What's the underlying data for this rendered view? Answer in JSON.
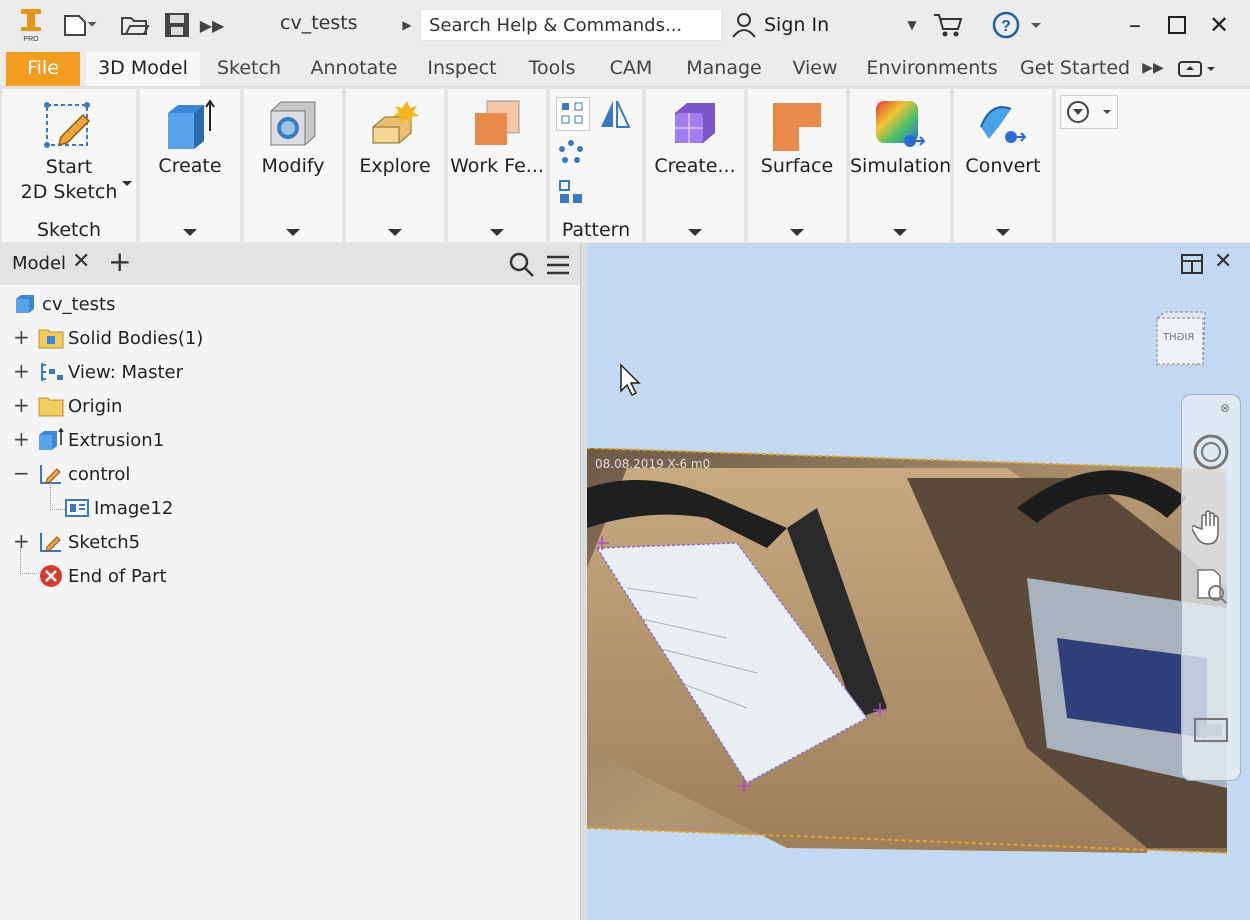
{
  "titlebar": {
    "doc_title": "cv_tests",
    "search_placeholder": "Search Help & Commands...",
    "sign_in": "Sign In"
  },
  "menu": {
    "tabs": [
      {
        "label": "File"
      },
      {
        "label": "3D Model"
      },
      {
        "label": "Sketch"
      },
      {
        "label": "Annotate"
      },
      {
        "label": "Inspect"
      },
      {
        "label": "Tools"
      },
      {
        "label": "CAM"
      },
      {
        "label": "Manage"
      },
      {
        "label": "View"
      },
      {
        "label": "Environments"
      },
      {
        "label": "Get Started"
      }
    ]
  },
  "ribbon": {
    "start_sketch": {
      "line1": "Start",
      "line2": "2D Sketch",
      "footer": "Sketch"
    },
    "panels": [
      {
        "label": "Create"
      },
      {
        "label": "Modify"
      },
      {
        "label": "Explore"
      },
      {
        "label": "Work Fe..."
      },
      {
        "label": "Create..."
      },
      {
        "label": "Surface"
      },
      {
        "label": "Simulation"
      },
      {
        "label": "Convert"
      }
    ],
    "pattern_footer": "Pattern"
  },
  "browser": {
    "tab_label": "Model",
    "root": "cv_tests",
    "nodes": [
      {
        "label": "Solid Bodies(1)"
      },
      {
        "label": "View: Master"
      },
      {
        "label": "Origin"
      },
      {
        "label": "Extrusion1"
      },
      {
        "label": "control"
      },
      {
        "label": "Image12"
      },
      {
        "label": "Sketch5"
      },
      {
        "label": "End of Part"
      }
    ]
  },
  "viewport": {
    "viewcube_label": "RIGHT",
    "photo_stamp": "08.08.2019 X-6 m0"
  },
  "colors": {
    "file_tab": "#f39c1f",
    "viewport_bg": "#c2d9f1"
  }
}
